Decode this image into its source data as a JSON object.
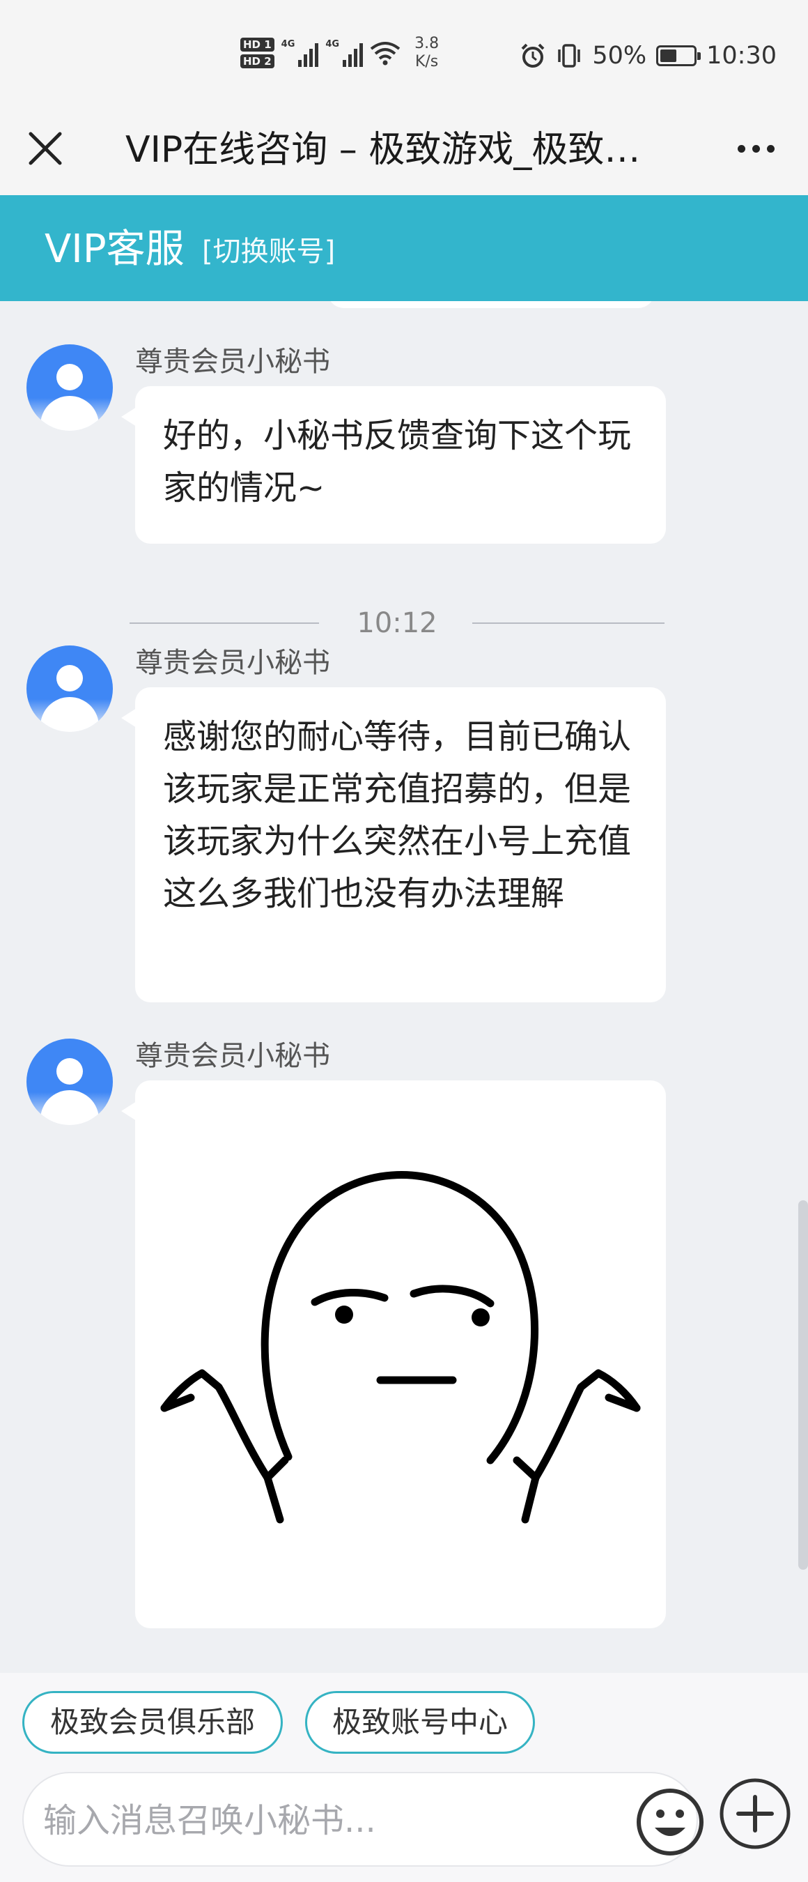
{
  "status_bar": {
    "hd1": "HD 1",
    "hd2": "HD 2",
    "network1": "4G",
    "network2": "4G",
    "speed_value": "3.8",
    "speed_unit": "K/s",
    "battery_percent": "50%",
    "battery_level": 0.5,
    "time": "10:30"
  },
  "title_bar": {
    "title": "VIP在线咨询 – 极致游戏_极致…"
  },
  "service_header": {
    "title": "VIP客服",
    "switch_account": "[切换账号]"
  },
  "messages": [
    {
      "sender": "尊贵会员小秘书",
      "text": "好的，小秘书反馈查询下这个玩家的情况~"
    },
    {
      "timestamp": "10:12",
      "sender": "尊贵会员小秘书",
      "text": "感谢您的耐心等待，目前已确认该玩家是正常充值招募的，但是该玩家为什么突然在小号上充值这么多我们也没有办法理解"
    },
    {
      "sender": "尊贵会员小秘书",
      "sticker": "shrug-face-sticker"
    }
  ],
  "quick_actions": [
    {
      "label": "极致会员俱乐部"
    },
    {
      "label": "极致账号中心"
    }
  ],
  "input": {
    "placeholder": "输入消息召唤小秘书..."
  },
  "colors": {
    "accent": "#33b5cc",
    "avatar_blue": "#3f87f5",
    "background": "#eef0f3"
  }
}
